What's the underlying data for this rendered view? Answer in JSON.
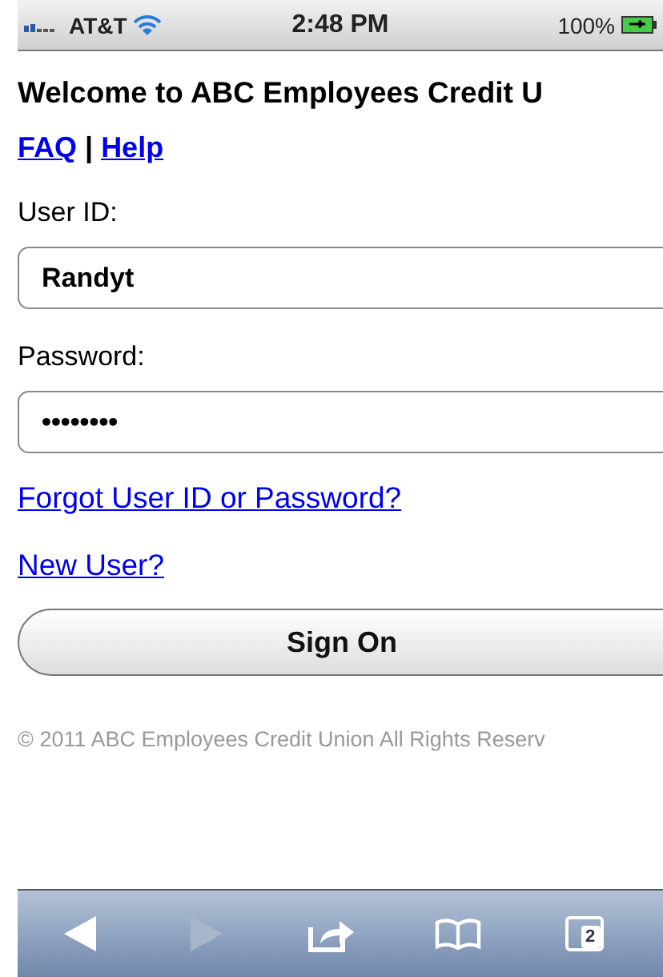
{
  "status_bar": {
    "carrier": "AT&T",
    "time": "2:48 PM",
    "battery": "100%"
  },
  "heading": "Welcome to ABC Employees Credit U",
  "links": [
    {
      "label": "FAQ"
    },
    {
      "label": "Help"
    }
  ],
  "separator": "|",
  "fields": [
    {
      "label": "User ID:",
      "value": "Randyt"
    },
    {
      "label": "Password:",
      "value": "••••••••"
    }
  ],
  "forgot_link": "Forgot User ID or Password?",
  "new_user_link": "New User?",
  "sign_on_button": "Sign On",
  "footer": "© 2011 ABC Employees Credit Union All Rights Reserv",
  "toolbar": [
    {
      "kind": "back",
      "disabled": false
    },
    {
      "kind": "forward",
      "disabled": true
    },
    {
      "kind": "share",
      "disabled": false
    },
    {
      "kind": "bookmarks",
      "disabled": false
    },
    {
      "kind": "tabs",
      "disabled": false,
      "count": "2"
    }
  ]
}
